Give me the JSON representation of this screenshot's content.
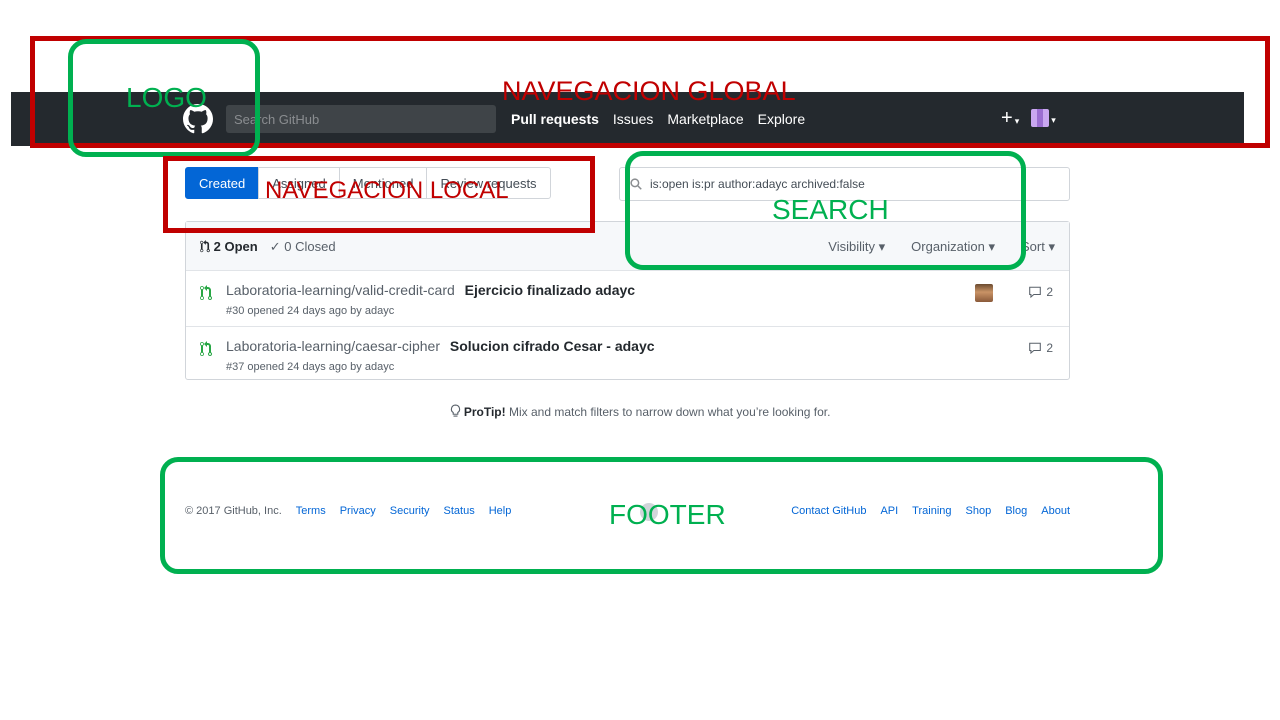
{
  "header": {
    "search_placeholder": "Search GitHub",
    "nav": [
      "Pull requests",
      "Issues",
      "Marketplace",
      "Explore"
    ],
    "plus_label": "+",
    "caret": "▾"
  },
  "tabs": [
    "Created",
    "Assigned",
    "Mentioned",
    "Review requests"
  ],
  "filter": {
    "value": "is:open is:pr author:adayc archived:false"
  },
  "list": {
    "open_label": "2 Open",
    "closed_label": "0 Closed",
    "filters": [
      "Visibility ▾",
      "Organization ▾",
      "Sort ▾"
    ],
    "rows": [
      {
        "repo": "Laboratoria-learning/valid-credit-card",
        "title": "Ejercicio finalizado adayc",
        "meta": "#30 opened 24 days ago by adayc",
        "comments": "2"
      },
      {
        "repo": "Laboratoria-learning/caesar-cipher",
        "title": "Solucion cifrado Cesar - adayc",
        "meta": "#37 opened 24 days ago by adayc",
        "comments": "2"
      }
    ]
  },
  "protip": {
    "bold": "ProTip!",
    "text": " Mix and match filters to narrow down what you’re looking for."
  },
  "footer": {
    "copyright": "© 2017 GitHub, Inc.",
    "left_links": [
      "Terms",
      "Privacy",
      "Security",
      "Status",
      "Help"
    ],
    "right_links": [
      "Contact GitHub",
      "API",
      "Training",
      "Shop",
      "Blog",
      "About"
    ]
  },
  "annotations": {
    "global_nav": "NAVEGACION GLOBAL",
    "logo": "LOGO",
    "local_nav": "NAVEGACION LOCAL",
    "search": "SEARCH",
    "footer": "FOOTER"
  },
  "colors": {
    "annotation_red": "#c00000",
    "annotation_green": "#00b050",
    "header_bg": "#24292e",
    "accent": "#0366d6"
  }
}
